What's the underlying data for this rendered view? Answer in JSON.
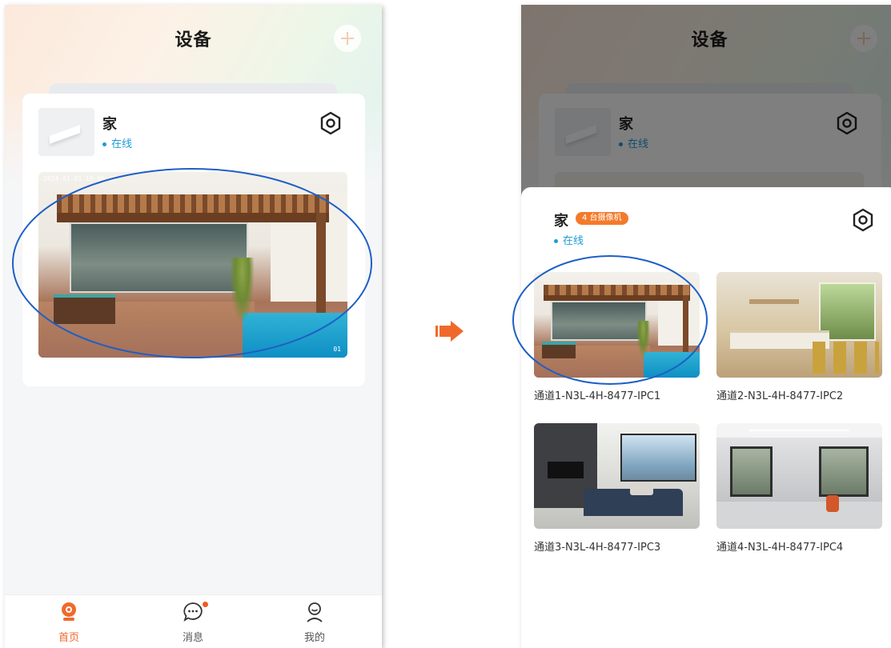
{
  "left_screen": {
    "header": {
      "title": "设备"
    },
    "site": {
      "name": "家",
      "status": "在线"
    },
    "preview": {
      "stamp": "2024-01-01 10:00:00",
      "channel_tag": "01"
    },
    "bottom_nav": [
      {
        "label": "首页",
        "icon": "home-camera-icon",
        "active": true
      },
      {
        "label": "消息",
        "icon": "message-icon",
        "active": false,
        "has_badge": true
      },
      {
        "label": "我的",
        "icon": "profile-icon",
        "active": false
      }
    ]
  },
  "right_screen": {
    "header": {
      "title": "设备"
    },
    "site": {
      "name": "家",
      "status": "在线"
    },
    "sheet": {
      "name": "家",
      "camera_count": "4 台摄像机",
      "status": "在线",
      "channels": [
        {
          "label": "通道1-N3L-4H-8477-IPC1",
          "scene": "patio"
        },
        {
          "label": "通道2-N3L-4H-8477-IPC2",
          "scene": "kitchen"
        },
        {
          "label": "通道3-N3L-4H-8477-IPC3",
          "scene": "living"
        },
        {
          "label": "通道4-N3L-4H-8477-IPC4",
          "scene": "office"
        }
      ]
    }
  },
  "colors": {
    "accent": "#f0692b",
    "online": "#1e9bd7",
    "annotation": "#1f5fc5",
    "badge": "#f47a2b"
  }
}
